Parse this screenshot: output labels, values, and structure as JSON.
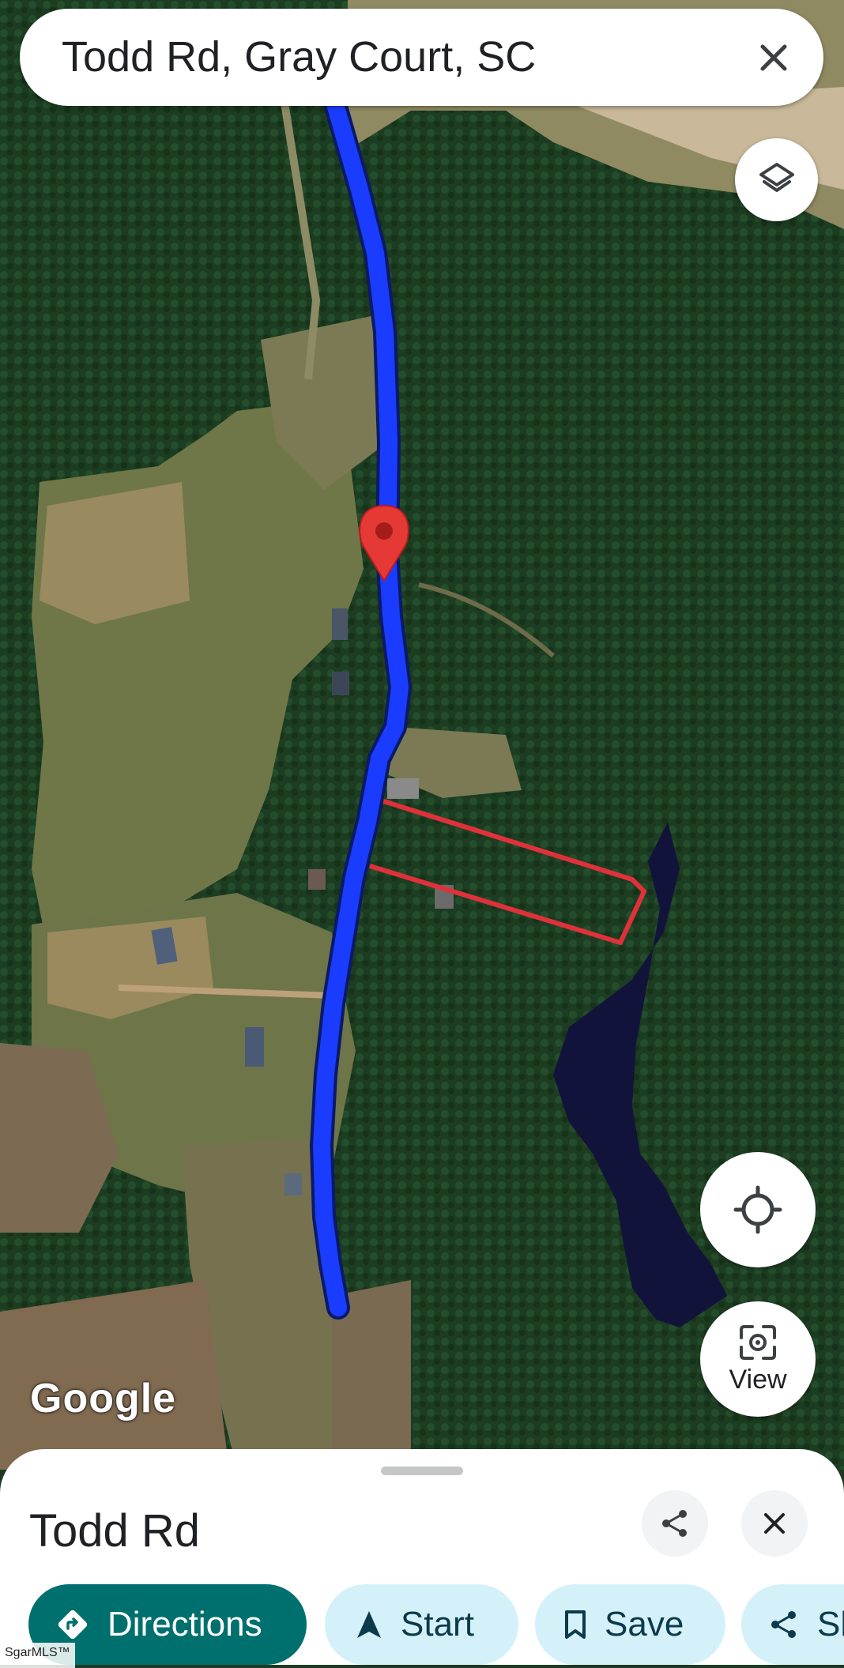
{
  "search": {
    "query": "Todd Rd, Gray Court, SC"
  },
  "map": {
    "attribution": "Google",
    "route_color": "#1a3cff",
    "pin_color": "#e53935",
    "parcel_outline_color": "#e0313b",
    "view_label": "View",
    "icons": [
      "layers-icon",
      "my-location-icon",
      "street-view-icon"
    ]
  },
  "place": {
    "title": "Todd Rd",
    "actions": {
      "directions": "Directions",
      "start": "Start",
      "save": "Save",
      "share": "Sh"
    }
  },
  "watermark": "SgarMLS™",
  "colors": {
    "directions_chip": "#00706e",
    "action_chip": "#d4f1fa"
  }
}
